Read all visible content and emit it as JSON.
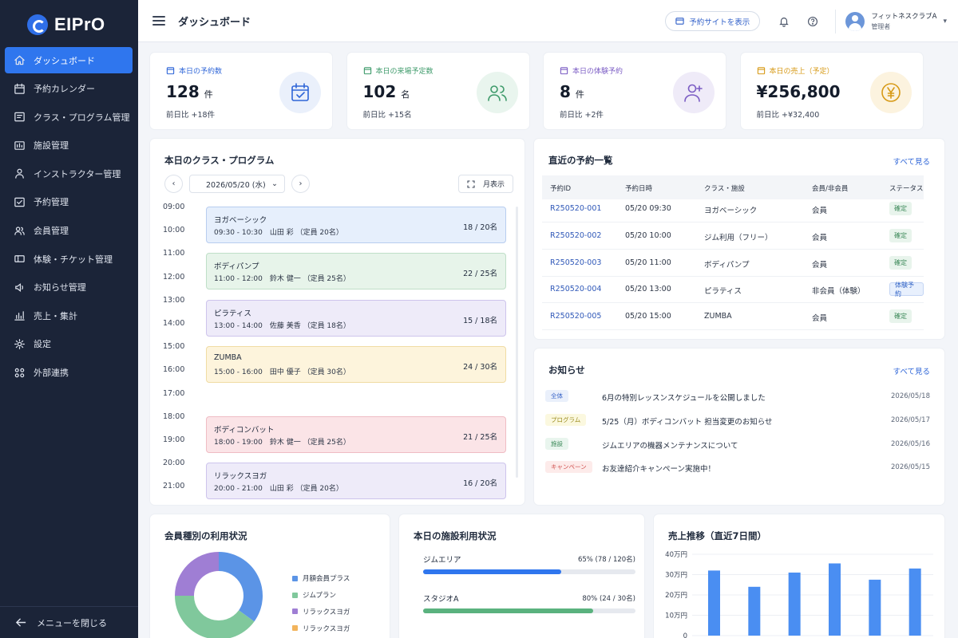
{
  "app": {
    "logo": "EIPrO"
  },
  "sidebar": {
    "items": [
      {
        "label": "ダッシュボード",
        "icon": "home-icon",
        "active": true
      },
      {
        "label": "予約カレンダー",
        "icon": "calendar-icon"
      },
      {
        "label": "クラス・プログラム管理",
        "icon": "class-icon"
      },
      {
        "label": "施設管理",
        "icon": "facility-icon"
      },
      {
        "label": "インストラクター管理",
        "icon": "instructor-icon"
      },
      {
        "label": "予約管理",
        "icon": "reservation-icon"
      },
      {
        "label": "会員管理",
        "icon": "members-icon"
      },
      {
        "label": "体験・チケット管理",
        "icon": "ticket-icon"
      },
      {
        "label": "お知らせ管理",
        "icon": "announcement-icon"
      },
      {
        "label": "売上・集計",
        "icon": "sales-chart-icon"
      },
      {
        "label": "設定",
        "icon": "gear-icon"
      },
      {
        "label": "外部連携",
        "icon": "integration-icon"
      }
    ],
    "close_label": "メニューを閉じる"
  },
  "header": {
    "title": "ダッシュボード",
    "site_button": "予約サイトを表示",
    "user_name": "フィットネスクラブA",
    "user_role": "管理者"
  },
  "stats": [
    {
      "label": "本日の予約数",
      "value": "128",
      "unit": "件",
      "sub": "前日比 +18件",
      "color": "#2f66d8",
      "bg": "#eaf0fb",
      "icon": "calendar-check-icon"
    },
    {
      "label": "本日の来場予定数",
      "value": "102",
      "unit": "名",
      "sub": "前日比 +15名",
      "color": "#3d9a6a",
      "bg": "#e9f5ee",
      "icon": "users-icon"
    },
    {
      "label": "本日の体験予約",
      "value": "8",
      "unit": "件",
      "sub": "前日比 +2件",
      "color": "#7b5cc4",
      "bg": "#efebf8",
      "icon": "user-plus-icon"
    },
    {
      "label": "本日の売上（予定）",
      "value": "¥256,800",
      "unit": "",
      "sub": "前日比 +¥32,400",
      "color": "#d79a17",
      "bg": "#fcf3df",
      "icon": "yen-coin-icon"
    }
  ],
  "schedule": {
    "title": "本日のクラス・プログラム",
    "date": "2026/05/20 (水)",
    "view_label": "月表示",
    "times": [
      "09:00",
      "10:00",
      "11:00",
      "12:00",
      "13:00",
      "14:00",
      "15:00",
      "16:00",
      "17:00",
      "18:00",
      "19:00",
      "20:00",
      "21:00"
    ],
    "classes": [
      {
        "name": "ヨガベーシック",
        "detail": "09:30 - 10:30　山田 彩 （定員 20名）",
        "count": "18 / 20名",
        "bg": "#e6effc",
        "border": "#b8cdef"
      },
      {
        "name": "ボディパンプ",
        "detail": "11:00 - 12:00　鈴木 健一 （定員 25名）",
        "count": "22 / 25名",
        "bg": "#e7f4ea",
        "border": "#bfdfc8"
      },
      {
        "name": "ピラティス",
        "detail": "13:00 - 14:00　佐藤 美香 （定員 18名）",
        "count": "15 / 18名",
        "bg": "#eeebf9",
        "border": "#cdc4ec"
      },
      {
        "name": "ZUMBA",
        "detail": "15:00 - 16:00　田中 優子 （定員 30名）",
        "count": "24 / 30名",
        "bg": "#fdf4dc",
        "border": "#f0dca4"
      },
      {
        "name": "ボディコンバット",
        "detail": "18:00 - 19:00　鈴木 健一 （定員 25名）",
        "count": "21 / 25名",
        "bg": "#fbe4e7",
        "border": "#efbcc4"
      },
      {
        "name": "リラックスヨガ",
        "detail": "20:00 - 21:00　山田 彩 （定員 20名）",
        "count": "16 / 20名",
        "bg": "#eeebf9",
        "border": "#cdc4ec"
      }
    ]
  },
  "reservations": {
    "title": "直近の予約一覧",
    "see_all": "すべて見る",
    "columns": [
      "予約ID",
      "予約日時",
      "クラス・施設",
      "会員/非会員",
      "ステータス"
    ],
    "rows": [
      {
        "id": "R250520-001",
        "datetime": "05/20 09:30",
        "class": "ヨガベーシック",
        "member": "会員",
        "status": "確定",
        "status_type": "ok"
      },
      {
        "id": "R250520-002",
        "datetime": "05/20 10:00",
        "class": "ジム利用（フリー）",
        "member": "会員",
        "status": "確定",
        "status_type": "ok"
      },
      {
        "id": "R250520-003",
        "datetime": "05/20 11:00",
        "class": "ボディパンプ",
        "member": "会員",
        "status": "確定",
        "status_type": "ok"
      },
      {
        "id": "R250520-004",
        "datetime": "05/20 13:00",
        "class": "ピラティス",
        "member": "非会員（体験）",
        "status": "体験予約",
        "status_type": "trial"
      },
      {
        "id": "R250520-005",
        "datetime": "05/20 15:00",
        "class": "ZUMBA",
        "member": "会員",
        "status": "確定",
        "status_type": "ok"
      }
    ]
  },
  "news": {
    "title": "お知らせ",
    "see_all": "すべて見る",
    "items": [
      {
        "tag": "全体",
        "text": "6月の特別レッスンスケジュールを公開しました",
        "date": "2026/05/18",
        "color": "#3b66c8",
        "bg": "#eaf0fb"
      },
      {
        "tag": "プログラム",
        "text": "5/25（月）ボディコンバット 担当変更のお知らせ",
        "date": "2026/05/17",
        "color": "#9a8a1a",
        "bg": "#fbf8df"
      },
      {
        "tag": "施設",
        "text": "ジムエリアの機器メンテナンスについて",
        "date": "2026/05/16",
        "color": "#3d8a5a",
        "bg": "#e9f5ee"
      },
      {
        "tag": "キャンペーン",
        "text": "お友達紹介キャンペーン実施中！",
        "date": "2026/05/15",
        "color": "#d0504e",
        "bg": "#fdebea"
      }
    ]
  },
  "membership": {
    "title": "会員種別の利用状況",
    "legend": [
      {
        "label": "月額会員プラス",
        "color": "#5b94e6"
      },
      {
        "label": "ジムプラン",
        "color": "#80c89c"
      },
      {
        "label": "リラックスヨガ",
        "color": "#9f7ed4"
      },
      {
        "label": "リラックスヨガ",
        "color": "#f2b45c"
      }
    ],
    "chart_data": {
      "type": "pie",
      "values": [
        35,
        40,
        25
      ],
      "colors": [
        "#5b94e6",
        "#80c89c",
        "#9f7ed4"
      ]
    }
  },
  "facility": {
    "title": "本日の施設利用状況",
    "rows": [
      {
        "label": "ジムエリア",
        "value": "65% (78 / 120名)",
        "fill": 0.65,
        "color": "#2f76ee"
      },
      {
        "label": "スタジオA",
        "value": "80% (24 / 30名)",
        "fill": 0.8,
        "color": "#5ab27e"
      }
    ]
  },
  "sales": {
    "title": "売上推移（直近7日間）",
    "chart_data": {
      "type": "bar",
      "values": [
        32,
        24,
        31,
        35.5,
        27.5,
        33
      ],
      "yticks": [
        "40万円",
        "30万円",
        "20万円",
        "10万円",
        "0"
      ],
      "ylim": [
        0,
        40
      ],
      "color": "#4a8ef2"
    }
  }
}
